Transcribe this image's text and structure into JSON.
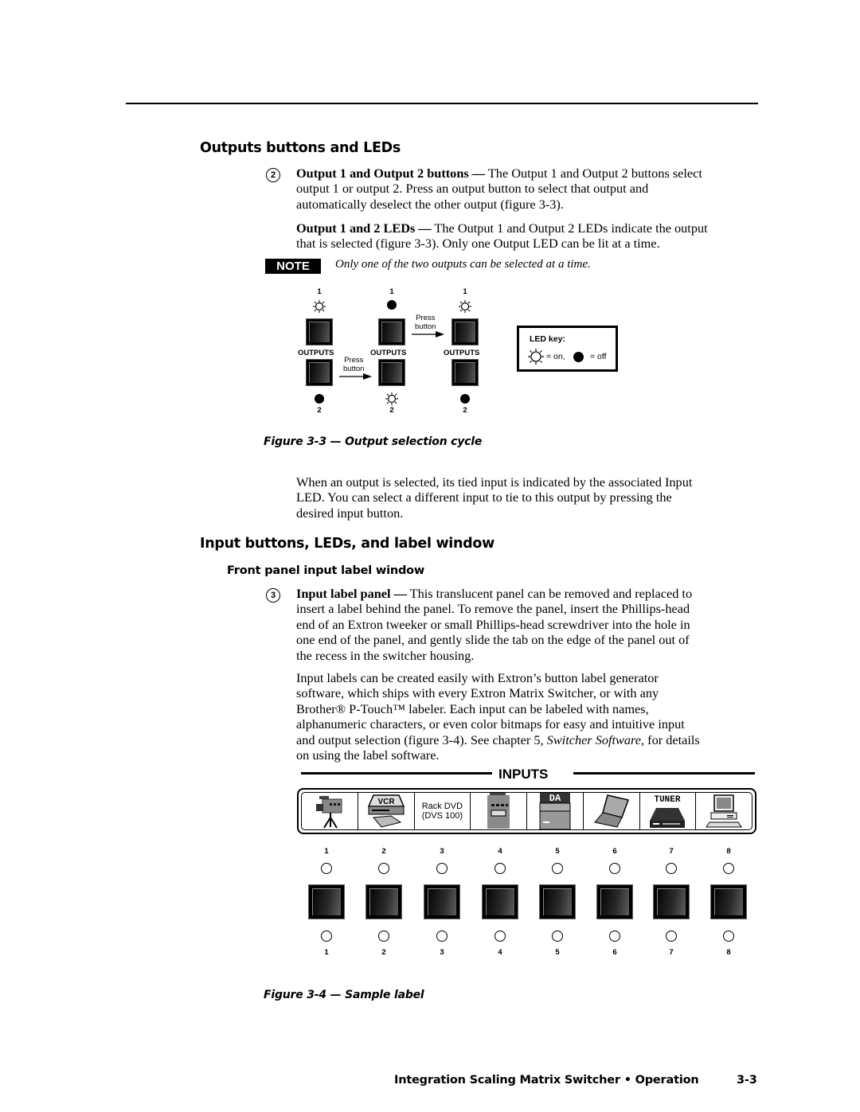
{
  "section1": {
    "heading": "Outputs buttons and LEDs",
    "item_number": "2",
    "para1_bold": "Output 1 and Output 2 buttons —",
    "para1_lines": [
      " The Output 1 and Output 2 buttons select",
      "output 1 or output 2.  Press an output button to select that output and",
      "automatically deselect the other output (figure 3-3)."
    ],
    "para2_bold": "Output 1 and 2 LEDs —",
    "para2_lines": [
      " The Output 1 and Output 2 LEDs indicate the output",
      "that is selected (figure 3-3).  Only one Output LED can be lit at a time."
    ],
    "note_label": "NOTE",
    "note_text": "Only one of the two outputs can be selected at a time."
  },
  "figure3": {
    "caption": "Figure 3-3 — Output selection cycle",
    "label_outputs": "OUTPUTS",
    "press_label_1": "Press",
    "press_label_2": "button",
    "top_number": "1",
    "bottom_number": "2",
    "states": [
      {
        "output1_led": "on",
        "output2_led": "off"
      },
      {
        "output1_led": "off",
        "output2_led": "on"
      },
      {
        "output1_led": "on",
        "output2_led": "off"
      }
    ],
    "led_key": {
      "title": "LED key:",
      "on_text": "= on,",
      "off_text": "= off"
    }
  },
  "para_tied": [
    "When an output is selected, its tied input is indicated by the associated Input",
    "LED.  You can select a different input to tie to this output by pressing the",
    "desired input button."
  ],
  "section2": {
    "heading": "Input buttons, LEDs, and label window",
    "subheading": "Front panel input label window",
    "item_number": "3",
    "para1_bold": "Input label panel —",
    "para1_lines": [
      " This translucent panel can be removed and replaced to",
      "insert a label behind the panel.  To remove the panel, insert the Phillips-head",
      "end of an Extron tweeker or small Phillips-head screwdriver into the hole in",
      "one end of the panel, and gently slide the tab on the edge of the panel out of",
      "the recess in the switcher housing."
    ],
    "para2_lines": [
      "Input labels can be created easily with Extron’s button label generator",
      "software, which ships with every Extron Matrix Switcher, or with any",
      "Brother® P-Touch™ labeler.  Each input can be labeled with names,",
      "alphanumeric characters, or even color bitmaps for easy and intuitive input"
    ],
    "para2_line5_a": "and output selection (figure 3-4).  See chapter 5, ",
    "para2_line5_italic": "Switcher Software",
    "para2_line5_b": ", for details",
    "para2_line6": "on using the label software."
  },
  "figure4": {
    "inputs_title": "INPUTS",
    "labels": [
      {
        "icon": "video-camera-icon"
      },
      {
        "icon": "vcr-icon",
        "text": "VCR"
      },
      {
        "text_line1": "Rack DVD",
        "text_line2": "(DVS 100)"
      },
      {
        "icon": "device-panel-icon"
      },
      {
        "icon": "distribution-amp-icon",
        "text": "DA"
      },
      {
        "icon": "laptop-icon"
      },
      {
        "icon": "tuner-icon",
        "text": "TUNER"
      },
      {
        "icon": "desktop-computer-icon"
      }
    ],
    "numbers": [
      "1",
      "2",
      "3",
      "4",
      "5",
      "6",
      "7",
      "8"
    ],
    "caption": "Figure 3-4 — Sample label"
  },
  "footer": {
    "title": "Integration Scaling Matrix Switcher • Operation",
    "page": "3-3"
  }
}
